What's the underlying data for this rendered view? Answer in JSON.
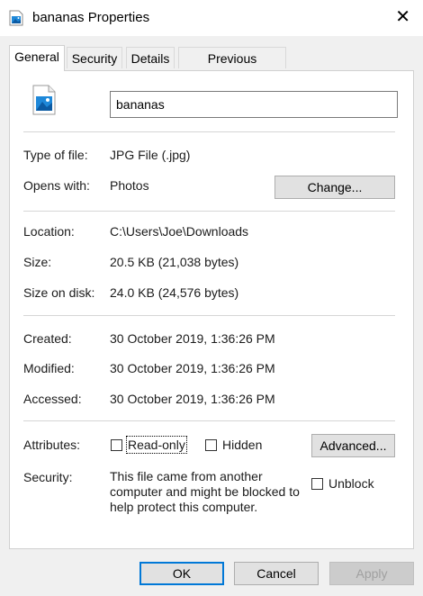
{
  "window": {
    "title": "bananas Properties",
    "close_glyph": "✕"
  },
  "tabs": [
    {
      "label": "General",
      "active": true
    },
    {
      "label": "Security",
      "active": false
    },
    {
      "label": "Details",
      "active": false
    },
    {
      "label": "Previous Versions",
      "active": false
    }
  ],
  "file": {
    "name": "bananas",
    "icon": "jpg-image-icon"
  },
  "type_section": {
    "type_label": "Type of file:",
    "type_value": "JPG File (.jpg)",
    "opens_label": "Opens with:",
    "opens_value": "Photos",
    "change_button": "Change..."
  },
  "location_section": {
    "location_label": "Location:",
    "location_value": "C:\\Users\\Joe\\Downloads",
    "size_label": "Size:",
    "size_value": "20.5 KB (21,038 bytes)",
    "size_disk_label": "Size on disk:",
    "size_disk_value": "24.0 KB (24,576 bytes)"
  },
  "dates_section": {
    "created_label": "Created:",
    "created_value": "30 October 2019, 1:36:26 PM",
    "modified_label": "Modified:",
    "modified_value": "30 October 2019, 1:36:26 PM",
    "accessed_label": "Accessed:",
    "accessed_value": "30 October 2019, 1:36:26 PM"
  },
  "attributes": {
    "label": "Attributes:",
    "readonly_label": "Read-only",
    "readonly_checked": false,
    "hidden_label": "Hidden",
    "hidden_checked": false,
    "advanced_button": "Advanced..."
  },
  "security": {
    "label": "Security:",
    "message": "This file came from another computer and might be blocked to help protect this computer.",
    "unblock_label": "Unblock",
    "unblock_checked": false
  },
  "footer": {
    "ok": "OK",
    "cancel": "Cancel",
    "apply": "Apply"
  },
  "colors": {
    "accent": "#0078d7",
    "panel_bg": "#ffffff",
    "dialog_bg": "#f0f0f0"
  }
}
